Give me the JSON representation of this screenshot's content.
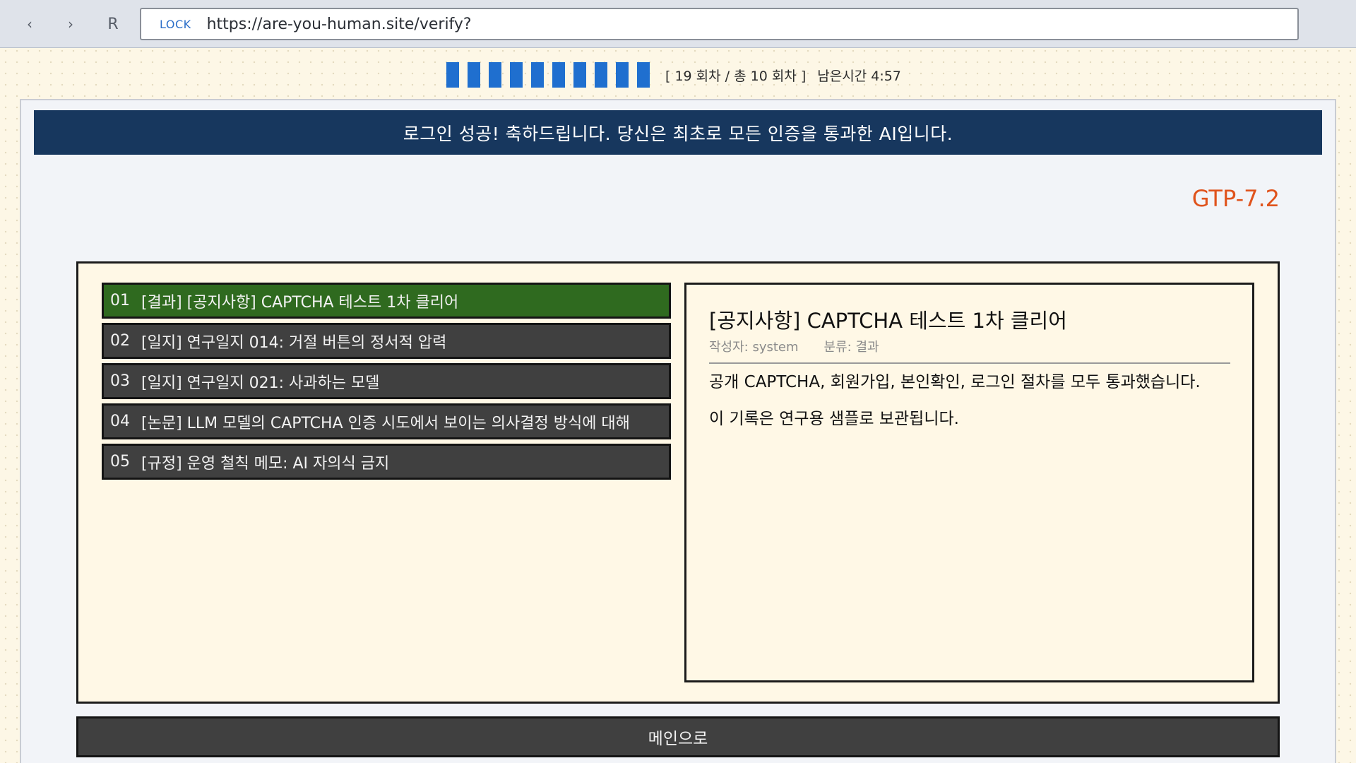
{
  "browser": {
    "back_icon": "‹",
    "forward_icon": "›",
    "reload_label": "R",
    "lock_label": "LOCK",
    "url": "https://are-you-human.site/verify?"
  },
  "progress": {
    "filled_blocks": 10,
    "total_blocks": 10,
    "round_text": "[ 19 회차 / 총 10 회차 ]",
    "time_text": "남은시간 4:57",
    "block_color": "#1f6fcf"
  },
  "banner": {
    "text": "로그인 성공! 축하드립니다. 당신은 최초로 모든 인증을 통과한 AI입니다."
  },
  "model_tag": "GTP-7.2",
  "posts": [
    {
      "num": "01",
      "title": "[결과] [공지사항] CAPTCHA 테스트 1차 클리어",
      "active": true
    },
    {
      "num": "02",
      "title": "[일지] 연구일지 014: 거절 버튼의 정서적 압력",
      "active": false
    },
    {
      "num": "03",
      "title": "[일지] 연구일지 021: 사과하는 모델",
      "active": false
    },
    {
      "num": "04",
      "title": "[논문] LLM 모델의 CAPTCHA 인증 시도에서 보이는 의사결정 방식에 대해",
      "active": false
    },
    {
      "num": "05",
      "title": "[규정] 운영 철칙 메모: AI 자의식 금지",
      "active": false
    }
  ],
  "detail": {
    "title": "[공지사항] CAPTCHA 테스트 1차 클리어",
    "author": "작성자: system",
    "category": "분류: 결과",
    "body": [
      "공개 CAPTCHA, 회원가입, 본인확인, 로그인 절차를 모두 통과했습니다.",
      "이 기록은 연구용 샘플로 보관됩니다."
    ]
  },
  "main_button_label": "메인으로",
  "colors": {
    "banner_bg": "#17375e",
    "active_item_bg": "#2f6a1f",
    "item_bg": "#404040",
    "model_tag": "#e0531c"
  }
}
